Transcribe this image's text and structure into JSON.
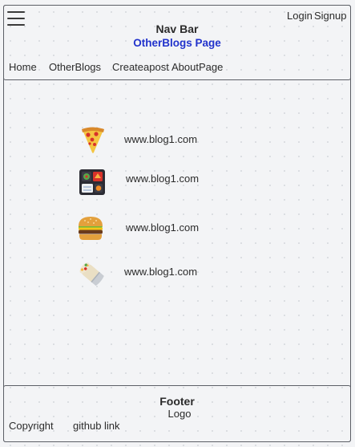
{
  "nav": {
    "title": "Nav Bar",
    "subtitle": "OtherBlogs Page",
    "login": "Login",
    "signup": "Signup",
    "menu_icon": "hamburger-menu-icon",
    "links": [
      "Home",
      "OtherBlogs",
      "Createapost",
      "AboutPage"
    ]
  },
  "blogs": [
    {
      "icon": "pizza-icon",
      "url": "www.blog1.com"
    },
    {
      "icon": "bento-box-icon",
      "url": "www.blog1.com"
    },
    {
      "icon": "burger-icon",
      "url": "www.blog1.com"
    },
    {
      "icon": "burrito-icon",
      "url": "www.blog1.com"
    }
  ],
  "footer": {
    "title": "Footer",
    "logo": "Logo",
    "copyright": "Copyright",
    "github": "github link"
  },
  "colors": {
    "accent": "#2233cc",
    "border": "#5c5f66",
    "background": "#f3f4f6"
  }
}
